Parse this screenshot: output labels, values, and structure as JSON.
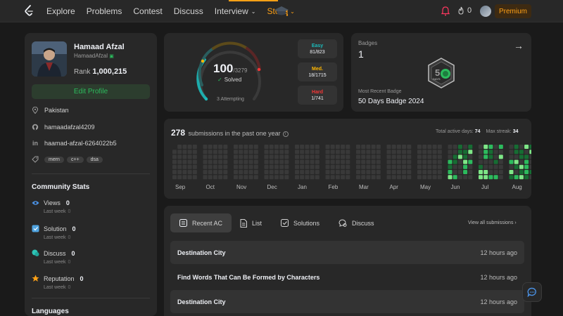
{
  "nav": {
    "items": [
      {
        "label": "Explore"
      },
      {
        "label": "Problems"
      },
      {
        "label": "Contest"
      },
      {
        "label": "Discuss"
      },
      {
        "label": "Interview"
      },
      {
        "label": "Store"
      }
    ],
    "streak_count": "0",
    "premium_label": "Premium"
  },
  "profile": {
    "name": "Hamaad Afzal",
    "username": "HamaadAfzal",
    "rank_label": "Rank",
    "rank_value": "1,000,215",
    "edit_label": "Edit Profile",
    "location": "Pakistan",
    "github": "hamaadafzal4209",
    "linkedin": "haamad-afzal-6264022b5",
    "tags": [
      "mern",
      "c++",
      "dsa"
    ]
  },
  "community": {
    "title": "Community Stats",
    "stats": [
      {
        "label": "Views",
        "value": "0",
        "sub": "Last week",
        "sub_value": "0"
      },
      {
        "label": "Solution",
        "value": "0",
        "sub": "Last week",
        "sub_value": "0"
      },
      {
        "label": "Discuss",
        "value": "0",
        "sub": "Last week",
        "sub_value": "0"
      },
      {
        "label": "Reputation",
        "value": "0",
        "sub": "Last week",
        "sub_value": "0"
      }
    ]
  },
  "languages_title": "Languages",
  "solved": {
    "count": "100",
    "total": "/3279",
    "label": "Solved",
    "attempting": "3 Attempting",
    "difficulty": [
      {
        "name": "Easy",
        "value": "81/823",
        "color": "#1cbaba"
      },
      {
        "name": "Med.",
        "value": "18/1715",
        "color": "#ffb700"
      },
      {
        "name": "Hard",
        "value": "1/741",
        "color": "#f63737"
      }
    ]
  },
  "badges": {
    "label": "Badges",
    "count": "1",
    "recent_label": "Most Recent Badge",
    "recent_name": "50 Days Badge 2024"
  },
  "heatmap": {
    "count": "278",
    "title_rest": "submissions in the past one year",
    "active_label": "Total active days:",
    "active_value": "74",
    "streak_label": "Max streak:",
    "streak_value": "34",
    "months": [
      "Sep",
      "Oct",
      "Nov",
      "Dec",
      "Jan",
      "Feb",
      "Mar",
      "Apr",
      "May",
      "Jun",
      "Jul",
      "Aug"
    ]
  },
  "submissions": {
    "tabs": [
      {
        "label": "Recent AC"
      },
      {
        "label": "List"
      },
      {
        "label": "Solutions"
      },
      {
        "label": "Discuss"
      }
    ],
    "view_all": "View all submissions",
    "rows": [
      {
        "title": "Destination City",
        "time": "12 hours ago"
      },
      {
        "title": "Find Words That Can Be Formed by Characters",
        "time": "12 hours ago"
      },
      {
        "title": "Destination City",
        "time": "12 hours ago"
      }
    ]
  }
}
